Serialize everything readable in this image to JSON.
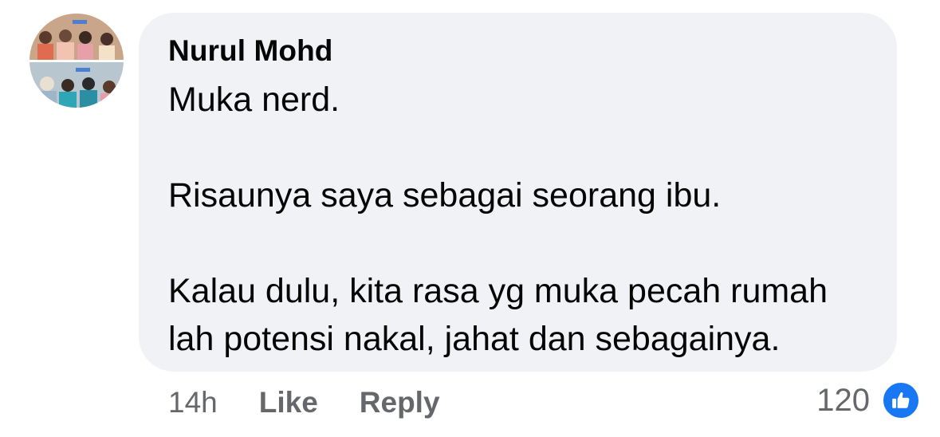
{
  "comment": {
    "author": "Nurul Mohd",
    "paragraphs": [
      "Muka nerd.",
      "Risaunya saya sebagai seorang ibu.",
      "Kalau dulu, kita rasa yg muka pecah rumah lah potensi nakal, jahat dan sebagainya."
    ],
    "timestamp": "14h",
    "like_label": "Like",
    "reply_label": "Reply",
    "reaction_count": "120",
    "reaction_icon": "thumbs-up-icon"
  },
  "colors": {
    "bubble": "#f0f2f5",
    "text": "#050505",
    "secondary_text": "#65676b",
    "like_blue": "#1877f2"
  }
}
